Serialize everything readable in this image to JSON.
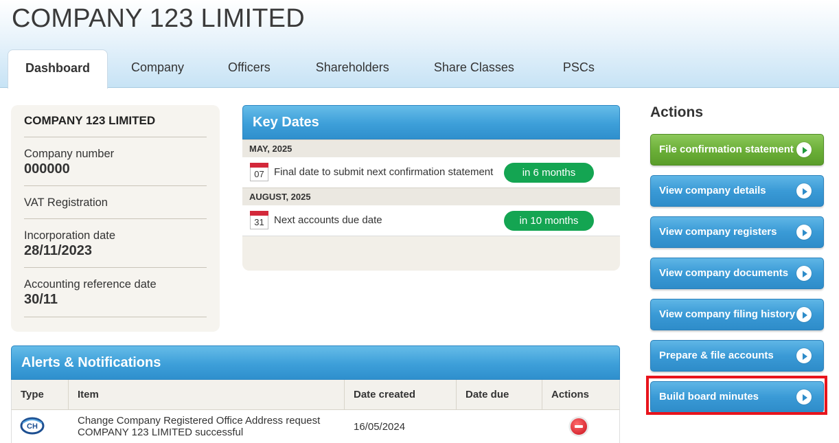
{
  "header": {
    "company_title": "COMPANY 123 LIMITED",
    "tabs": [
      {
        "label": "Dashboard",
        "active": true
      },
      {
        "label": "Company"
      },
      {
        "label": "Officers"
      },
      {
        "label": "Shareholders"
      },
      {
        "label": "Share Classes"
      },
      {
        "label": "PSCs"
      }
    ]
  },
  "company_info": {
    "name": "COMPANY 123 LIMITED",
    "fields": [
      {
        "label": "Company number",
        "value": "000000"
      },
      {
        "label": "VAT Registration",
        "value": ""
      },
      {
        "label": "Incorporation date",
        "value": "28/11/2023"
      },
      {
        "label": "Accounting reference date",
        "value": "30/11"
      }
    ]
  },
  "key_dates": {
    "title": "Key Dates",
    "groups": [
      {
        "month": "MAY, 2025",
        "items": [
          {
            "day": "07",
            "text": "Final date to submit next confirmation statement",
            "due": "in 6 months"
          }
        ]
      },
      {
        "month": "AUGUST, 2025",
        "items": [
          {
            "day": "31",
            "text": "Next accounts due date",
            "due": "in 10 months"
          }
        ]
      }
    ],
    "pill_color": "#14a552",
    "calendar_color": "#d3283a"
  },
  "alerts": {
    "title": "Alerts & Notifications",
    "columns": [
      "Type",
      "Item",
      "Date created",
      "Date due",
      "Actions"
    ],
    "rows": [
      {
        "type_icon": "companies-house-icon",
        "item_line1": "Change Company Registered Office Address request",
        "item_line2": "COMPANY 123 LIMITED successful",
        "date_created": "16/05/2024",
        "date_due": "",
        "action_icon": "remove-icon"
      }
    ]
  },
  "actions": {
    "title": "Actions",
    "buttons": [
      {
        "label": "File confirmation statement",
        "color": "green"
      },
      {
        "label": "View company details",
        "color": "blue"
      },
      {
        "label": "View company registers",
        "color": "blue"
      },
      {
        "label": "View company documents",
        "color": "blue"
      },
      {
        "label": "View company filing history",
        "color": "blue"
      },
      {
        "label": "Prepare & file accounts",
        "color": "blue"
      },
      {
        "label": "Build board minutes",
        "color": "blue",
        "highlighted": true
      }
    ],
    "highlight_color": "#e8141c"
  },
  "colors": {
    "accent_blue": "#3a9ad6",
    "accent_green": "#6aae37"
  }
}
